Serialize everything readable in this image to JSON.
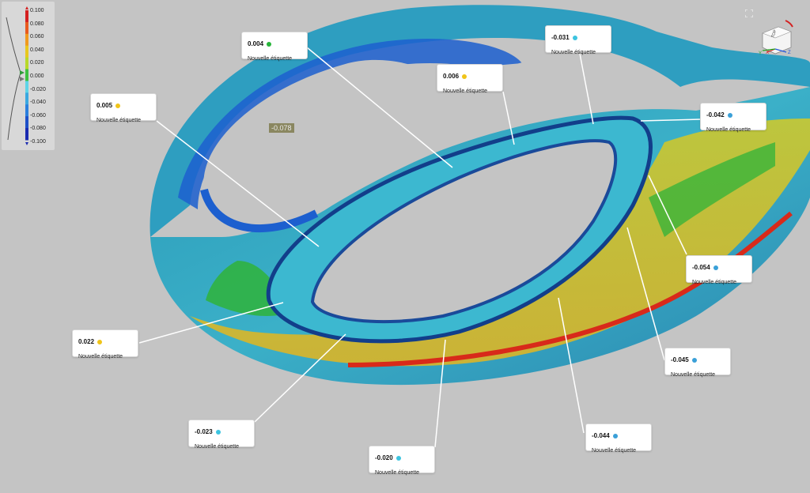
{
  "legend": {
    "ticks": [
      "0.100",
      "0.080",
      "0.060",
      "0.040",
      "0.020",
      "0.000",
      "-0.020",
      "-0.040",
      "-0.060",
      "-0.080",
      "-0.100"
    ],
    "colors": [
      "#d42020",
      "#e85a1e",
      "#f09a1e",
      "#e8c71e",
      "#b8d82a",
      "#3cc040",
      "#5ed4e8",
      "#3aa8e0",
      "#2b7fdd",
      "#1e50c8",
      "#1a2ab0"
    ]
  },
  "floating_value": "-0.078",
  "labels": [
    {
      "value": "0.004",
      "name": "Nouvelle étiquette",
      "color": "#27b53a"
    },
    {
      "value": "-0.031",
      "name": "Nouvelle étiquette",
      "color": "#3cc4e0"
    },
    {
      "value": "0.006",
      "name": "Nouvelle étiquette",
      "color": "#f0c419"
    },
    {
      "value": "0.005",
      "name": "Nouvelle étiquette",
      "color": "#f0c419"
    },
    {
      "value": "-0.042",
      "name": "Nouvelle étiquette",
      "color": "#3aa0d8"
    },
    {
      "value": "-0.054",
      "name": "Nouvelle étiquette",
      "color": "#3aa0d8"
    },
    {
      "value": "0.022",
      "name": "Nouvelle étiquette",
      "color": "#f0c419"
    },
    {
      "value": "-0.045",
      "name": "Nouvelle étiquette",
      "color": "#3aa0d8"
    },
    {
      "value": "-0.023",
      "name": "Nouvelle étiquette",
      "color": "#3cc4e0"
    },
    {
      "value": "-0.044",
      "name": "Nouvelle étiquette",
      "color": "#3aa0d8"
    },
    {
      "value": "-0.020",
      "name": "Nouvelle étiquette",
      "color": "#3cc4e0"
    }
  ],
  "view_cube": {
    "face": "TOP",
    "axes": [
      "X",
      "Y",
      "Z"
    ]
  },
  "icons": {
    "fullscreen": "fullscreen-icon",
    "rotate": "rotate-icon"
  }
}
